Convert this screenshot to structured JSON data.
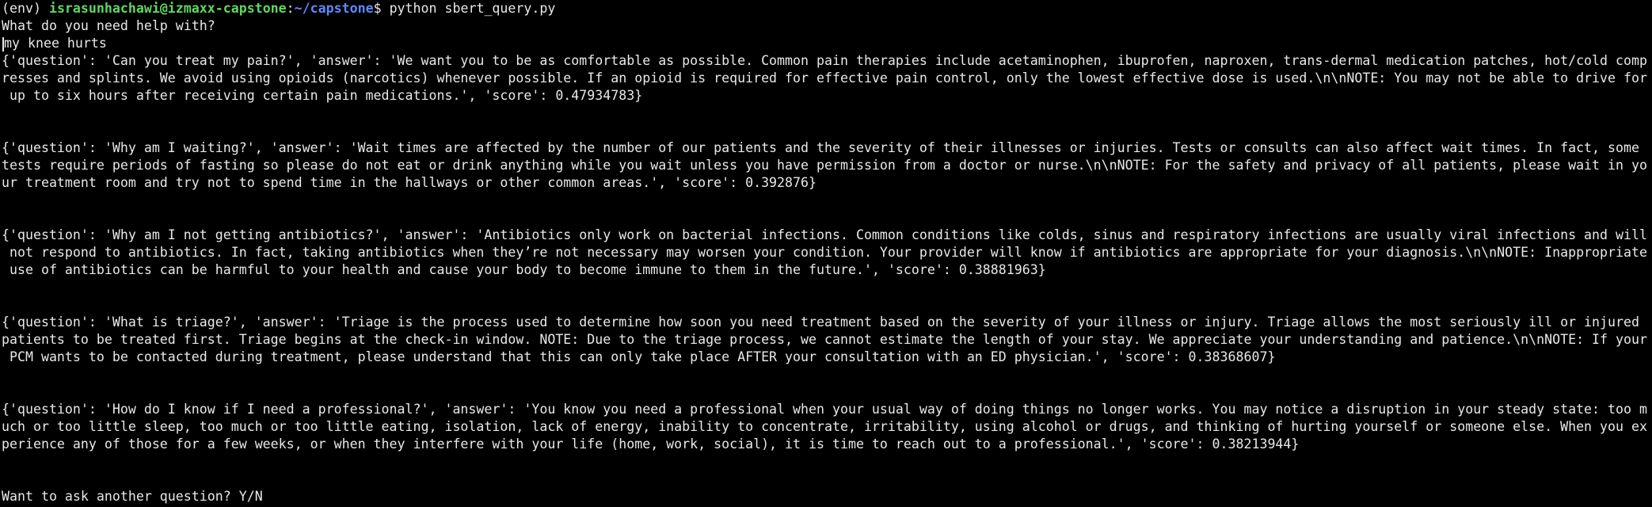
{
  "terminal": {
    "prompt": {
      "env": "(env) ",
      "user_host": "israsunhachawi@izmaxx-capstone",
      "separator": ":",
      "cwd": "~/capstone",
      "symbol": "$ ",
      "command": "python sbert_query.py"
    },
    "question_prompt": "What do you need help with?",
    "user_input": "my knee hurts",
    "results": [
      {
        "lines": [
          "{'question': 'Can you treat my pain?', 'answer': 'We want you to be as comfortable as possible. Common pain therapies include acetaminophen, ibuprofen, naproxen, trans-dermal medication patches, hot/cold comp",
          "resses and splints. We avoid using opioids (narcotics) whenever possible. If an opioid is required for effective pain control, only the lowest effective dose is used.\\n\\nNOTE: You may not be able to drive for",
          " up to six hours after receiving certain pain medications.', 'score': 0.47934783}"
        ]
      },
      {
        "lines": [
          "{'question': 'Why am I waiting?', 'answer': 'Wait times are affected by the number of our patients and the severity of their illnesses or injuries. Tests or consults can also affect wait times. In fact, some",
          "tests require periods of fasting so please do not eat or drink anything while you wait unless you have permission from a doctor or nurse.\\n\\nNOTE: For the safety and privacy of all patients, please wait in yo",
          "ur treatment room and try not to spend time in the hallways or other common areas.', 'score': 0.392876}"
        ]
      },
      {
        "lines": [
          "{'question': 'Why am I not getting antibiotics?', 'answer': 'Antibiotics only work on bacterial infections. Common conditions like colds, sinus and respiratory infections are usually viral infections and will",
          " not respond to antibiotics. In fact, taking antibiotics when they’re not necessary may worsen your condition. Your provider will know if antibiotics are appropriate for your diagnosis.\\n\\nNOTE: Inappropriate",
          " use of antibiotics can be harmful to your health and cause your body to become immune to them in the future.', 'score': 0.38881963}"
        ]
      },
      {
        "lines": [
          "{'question': 'What is triage?', 'answer': 'Triage is the process used to determine how soon you need treatment based on the severity of your illness or injury. Triage allows the most seriously ill or injured",
          "patients to be treated first. Triage begins at the check-in window. NOTE: Due to the triage process, we cannot estimate the length of your stay. We appreciate your understanding and patience.\\n\\nNOTE: If your",
          " PCM wants to be contacted during treatment, please understand that this can only take place AFTER your consultation with an ED physician.', 'score': 0.38368607}"
        ]
      },
      {
        "lines": [
          "{'question': 'How do I know if I need a professional?', 'answer': 'You know you need a professional when your usual way of doing things no longer works. You may notice a disruption in your steady state: too m",
          "uch or too little sleep, too much or too little eating, isolation, lack of energy, inability to concentrate, irritability, using alcohol or drugs, and thinking of hurting yourself or someone else. When you ex",
          "perience any of those for a few weeks, or when they interfere with your life (home, work, social), it is time to reach out to a professional.', 'score': 0.38213944}"
        ]
      }
    ],
    "followup_prompt": "Want to ask another question? Y/N"
  }
}
